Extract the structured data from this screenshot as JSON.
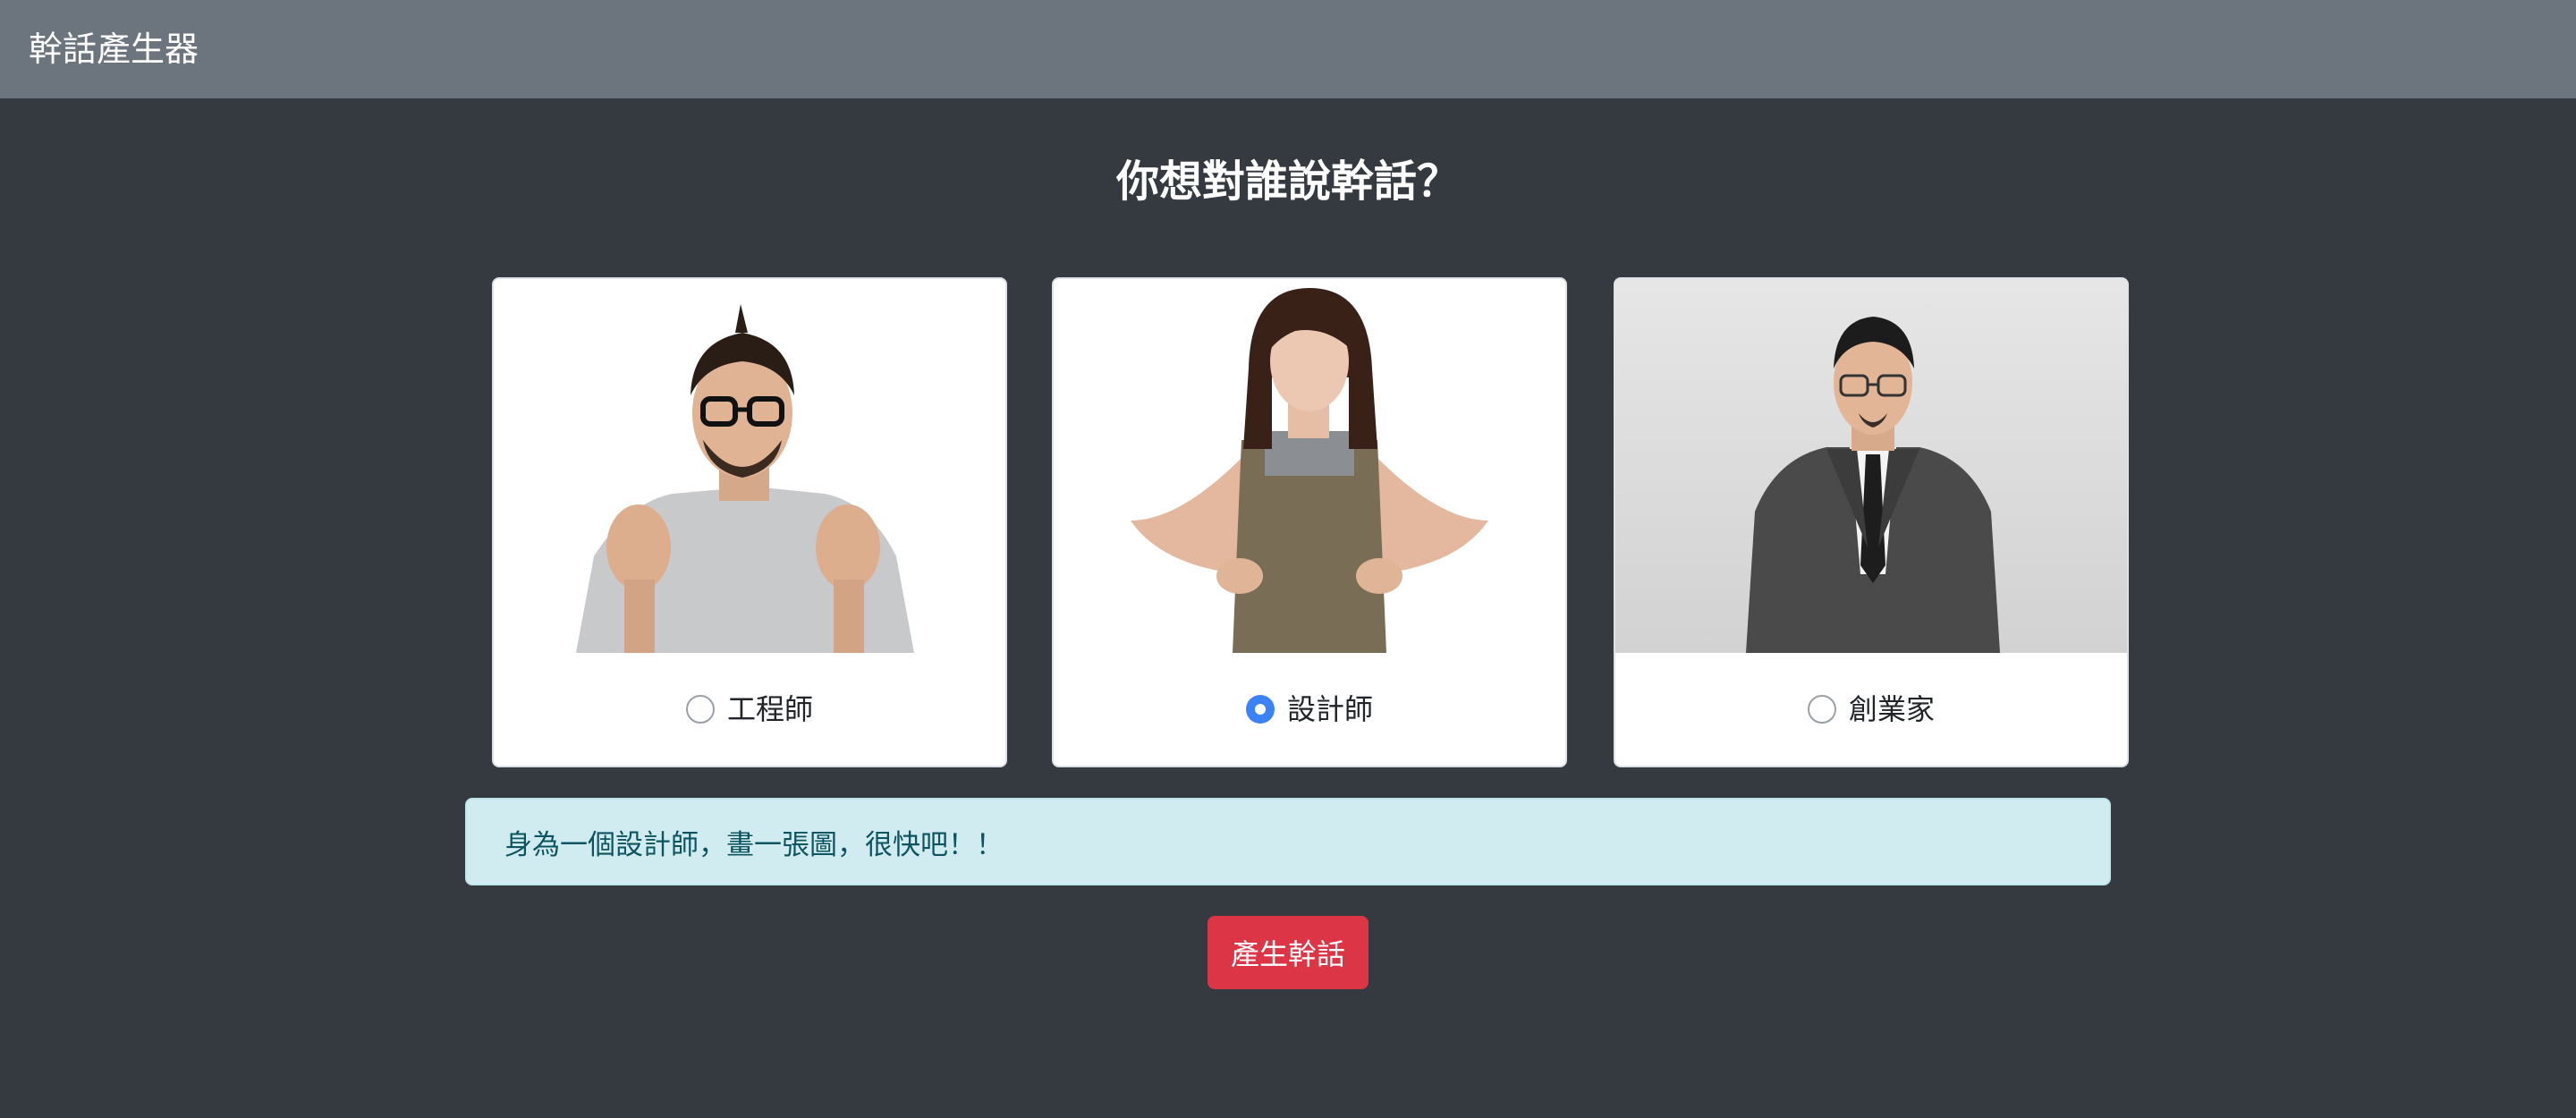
{
  "navbar": {
    "brand": "幹話產生器"
  },
  "main": {
    "heading": "你想對誰說幹話？",
    "options": [
      {
        "label": "工程師",
        "checked": false
      },
      {
        "label": "設計師",
        "checked": true
      },
      {
        "label": "創業家",
        "checked": false
      }
    ],
    "message": "身為一個設計師，畫一張圖，很快吧！！",
    "generate_label": "產生幹話"
  },
  "colors": {
    "navbar_bg": "#6c757d",
    "page_bg": "#343a40",
    "accent_radio": "#3b82f6",
    "alert_bg": "#d1ecf1",
    "alert_text": "#0c5460",
    "button_bg": "#dc3545"
  }
}
